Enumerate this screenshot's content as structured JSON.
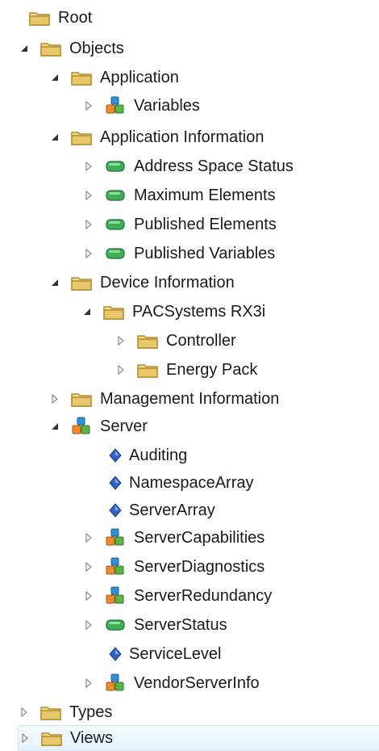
{
  "tree": {
    "root": "Root",
    "objects": "Objects",
    "application": "Application",
    "variables": "Variables",
    "application_information": "Application Information",
    "address_space_status": "Address Space Status",
    "maximum_elements": "Maximum Elements",
    "published_elements": "Published Elements",
    "published_variables": "Published Variables",
    "device_information": "Device Information",
    "pacsystems": "PACSystems RX3i",
    "controller": "Controller",
    "energy_pack": "Energy Pack",
    "management_information": "Management Information",
    "server": "Server",
    "auditing": "Auditing",
    "namespace_array": "NamespaceArray",
    "server_array": "ServerArray",
    "server_capabilities": "ServerCapabilities",
    "server_diagnostics": "ServerDiagnostics",
    "server_redundancy": "ServerRedundancy",
    "server_status": "ServerStatus",
    "service_level": "ServiceLevel",
    "vendor_server_info": "VendorServerInfo",
    "types": "Types",
    "views": "Views"
  },
  "icons": {
    "folder": "folder-icon",
    "object": "object-cubes-icon",
    "variable": "variable-green-icon",
    "property": "property-blue-diamond-icon",
    "expanded": "expanded-arrow-icon",
    "collapsed": "collapsed-arrow-icon"
  },
  "colors": {
    "folder": "#e9c86c",
    "variable": "#3fae55",
    "property": "#2f63c9",
    "cube_blue": "#2f8fd8",
    "cube_green": "#59b546",
    "cube_orange": "#f08a2c",
    "selection": "#e6f2fd"
  }
}
